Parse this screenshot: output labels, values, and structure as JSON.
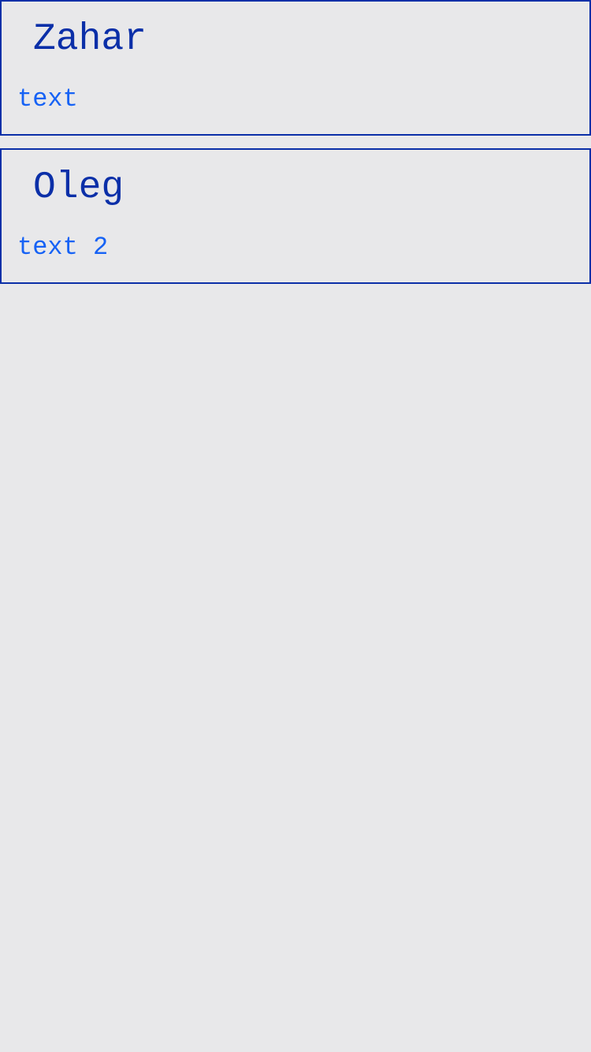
{
  "cards": [
    {
      "title": "Zahar",
      "text": "text"
    },
    {
      "title": "Oleg",
      "text": "text 2"
    }
  ],
  "colors": {
    "background": "#e8e8ea",
    "border": "#0b2fa8",
    "title": "#0b2fa8",
    "body_text": "#1662f5"
  }
}
